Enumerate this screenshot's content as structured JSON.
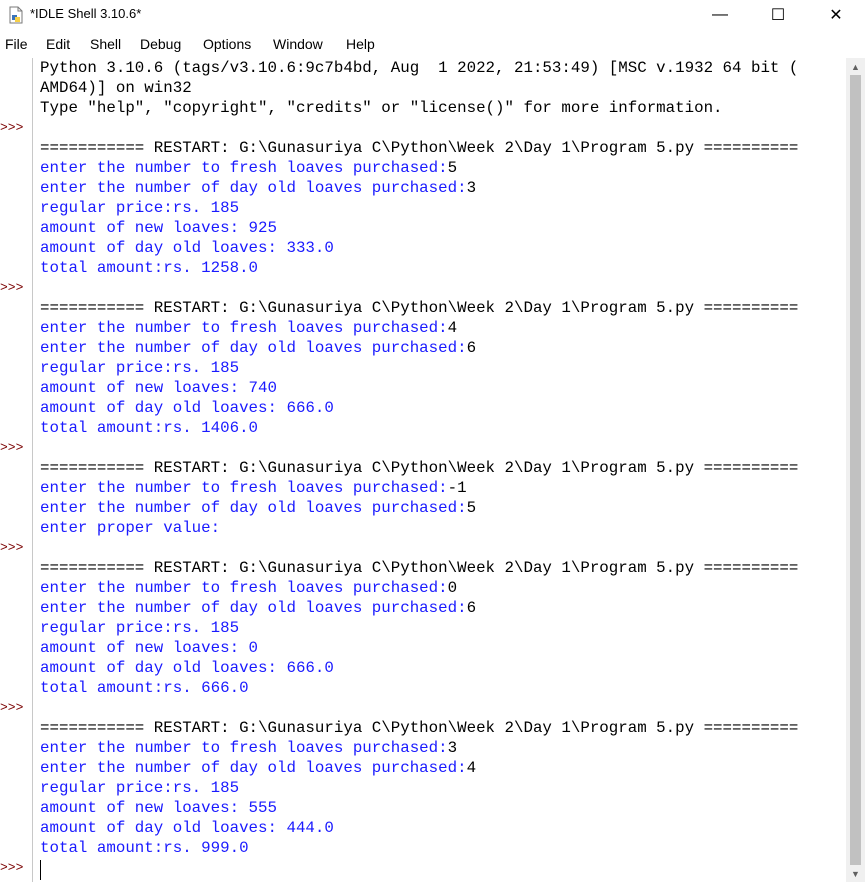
{
  "window": {
    "title": "*IDLE Shell 3.10.6*",
    "minimize_glyph": "—",
    "maximize_glyph": "☐",
    "close_glyph": "✕",
    "app_icon": "idle-file-icon"
  },
  "menu": [
    "File",
    "Edit",
    "Shell",
    "Debug",
    "Options",
    "Window",
    "Help"
  ],
  "prompts": [
    ">>>",
    ">>>",
    ">>>",
    ">>>",
    ">>>",
    ">>>"
  ],
  "lines": [
    {
      "text": "Python 3.10.6 (tags/v3.10.6:9c7b4bd, Aug  1 2022, 21:53:49) [MSC v.1932 64 bit (",
      "kind": "std"
    },
    {
      "text": "AMD64)] on win32",
      "kind": "std"
    },
    {
      "text": "Type \"help\", \"copyright\", \"credits\" or \"license()\" for more information.",
      "kind": "std"
    },
    {
      "text": "",
      "kind": "std"
    },
    {
      "text": "=========== RESTART: G:\\Gunasuriya C\\Python\\Week 2\\Day 1\\Program 5.py ==========",
      "kind": "std"
    },
    {
      "text": "enter the number to fresh loaves purchased:",
      "input": "5",
      "kind": "out"
    },
    {
      "text": "enter the number of day old loaves purchased:",
      "input": "3",
      "kind": "out"
    },
    {
      "text": "regular price:rs. 185",
      "kind": "out"
    },
    {
      "text": "amount of new loaves: 925",
      "kind": "out"
    },
    {
      "text": "amount of day old loaves: 333.0",
      "kind": "out"
    },
    {
      "text": "total amount:rs. 1258.0",
      "kind": "out"
    },
    {
      "text": "",
      "kind": "std"
    },
    {
      "text": "=========== RESTART: G:\\Gunasuriya C\\Python\\Week 2\\Day 1\\Program 5.py ==========",
      "kind": "std"
    },
    {
      "text": "enter the number to fresh loaves purchased:",
      "input": "4",
      "kind": "out"
    },
    {
      "text": "enter the number of day old loaves purchased:",
      "input": "6",
      "kind": "out"
    },
    {
      "text": "regular price:rs. 185",
      "kind": "out"
    },
    {
      "text": "amount of new loaves: 740",
      "kind": "out"
    },
    {
      "text": "amount of day old loaves: 666.0",
      "kind": "out"
    },
    {
      "text": "total amount:rs. 1406.0",
      "kind": "out"
    },
    {
      "text": "",
      "kind": "std"
    },
    {
      "text": "=========== RESTART: G:\\Gunasuriya C\\Python\\Week 2\\Day 1\\Program 5.py ==========",
      "kind": "std"
    },
    {
      "text": "enter the number to fresh loaves purchased:",
      "input": "-1",
      "kind": "out"
    },
    {
      "text": "enter the number of day old loaves purchased:",
      "input": "5",
      "kind": "out"
    },
    {
      "text": "enter proper value:",
      "kind": "out"
    },
    {
      "text": "",
      "kind": "std"
    },
    {
      "text": "=========== RESTART: G:\\Gunasuriya C\\Python\\Week 2\\Day 1\\Program 5.py ==========",
      "kind": "std"
    },
    {
      "text": "enter the number to fresh loaves purchased:",
      "input": "0",
      "kind": "out"
    },
    {
      "text": "enter the number of day old loaves purchased:",
      "input": "6",
      "kind": "out"
    },
    {
      "text": "regular price:rs. 185",
      "kind": "out"
    },
    {
      "text": "amount of new loaves: 0",
      "kind": "out"
    },
    {
      "text": "amount of day old loaves: 666.0",
      "kind": "out"
    },
    {
      "text": "total amount:rs. 666.0",
      "kind": "out"
    },
    {
      "text": "",
      "kind": "std"
    },
    {
      "text": "=========== RESTART: G:\\Gunasuriya C\\Python\\Week 2\\Day 1\\Program 5.py ==========",
      "kind": "std"
    },
    {
      "text": "enter the number to fresh loaves purchased:",
      "input": "3",
      "kind": "out"
    },
    {
      "text": "enter the number of day old loaves purchased:",
      "input": "4",
      "kind": "out"
    },
    {
      "text": "regular price:rs. 185",
      "kind": "out"
    },
    {
      "text": "amount of new loaves: 555",
      "kind": "out"
    },
    {
      "text": "amount of day old loaves: 444.0",
      "kind": "out"
    },
    {
      "text": "total amount:rs. 999.0",
      "kind": "out"
    }
  ],
  "scrollbar": {
    "up_glyph": "▲",
    "down_glyph": "▼"
  },
  "colors": {
    "stdout": "#1a1aff",
    "prompt": "#7a0000",
    "text": "#000000"
  }
}
